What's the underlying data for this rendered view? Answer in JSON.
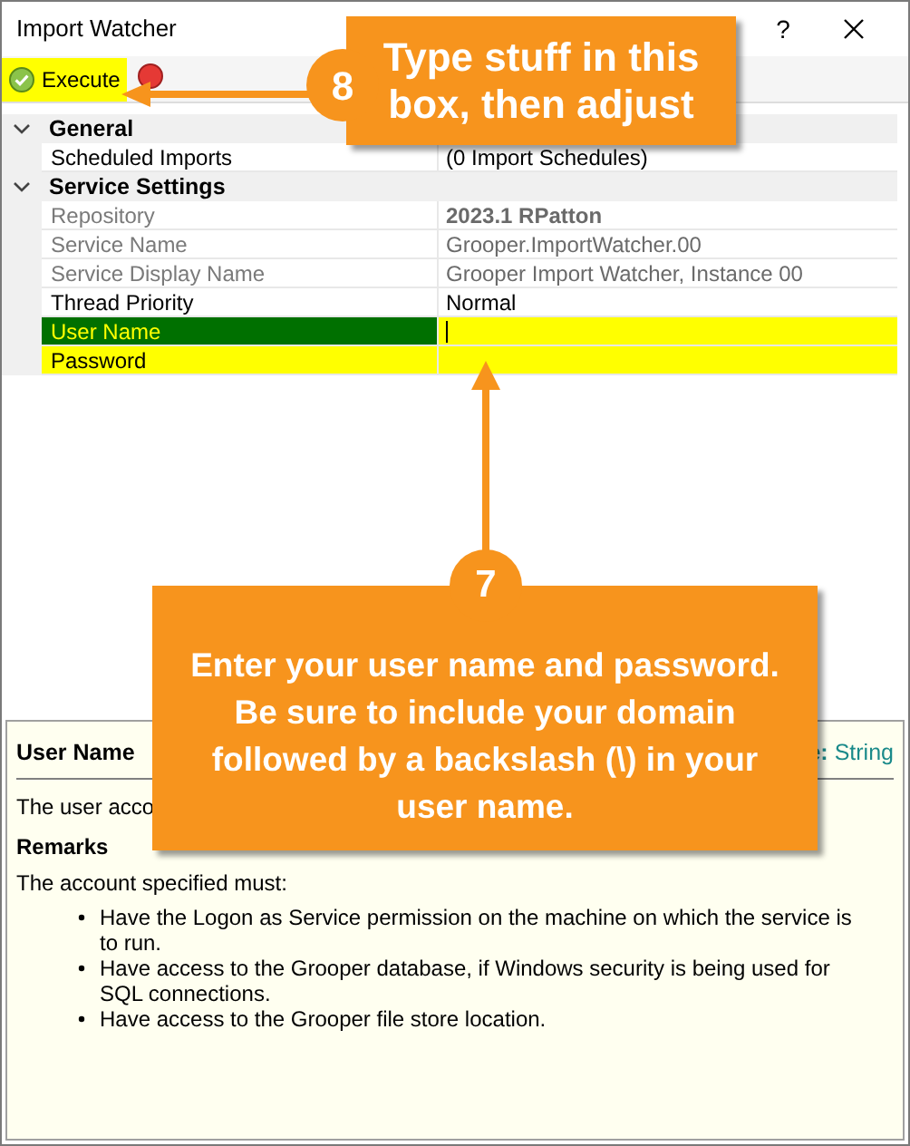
{
  "window": {
    "title": "Import Watcher",
    "help_button": "?"
  },
  "toolbar": [
    {
      "kind": "execute",
      "label": "Execute",
      "highlighted": true
    },
    {
      "kind": "cancel",
      "highlighted": false
    }
  ],
  "property_grid": [
    {
      "name": "General",
      "expanded": true,
      "properties": [
        {
          "name": "Scheduled Imports",
          "value": "(0 Import Schedules)",
          "disabled": false,
          "bold": false,
          "selected": false,
          "highlighted": false
        }
      ]
    },
    {
      "name": "Service Settings",
      "expanded": true,
      "properties": [
        {
          "name": "Repository",
          "value": "2023.1 RPatton",
          "disabled": true,
          "bold": true,
          "selected": false,
          "highlighted": false
        },
        {
          "name": "Service Name",
          "value": "Grooper.ImportWatcher.00",
          "disabled": true,
          "bold": false,
          "selected": false,
          "highlighted": false
        },
        {
          "name": "Service Display Name",
          "value": "Grooper Import Watcher, Instance 00",
          "disabled": true,
          "bold": false,
          "selected": false,
          "highlighted": false
        },
        {
          "name": "Thread Priority",
          "value": "Normal",
          "disabled": false,
          "bold": false,
          "selected": false,
          "highlighted": false
        },
        {
          "name": "User Name",
          "disabled": false,
          "bold": false,
          "selected": true,
          "highlighted": true
        },
        {
          "name": "Password",
          "disabled": false,
          "bold": false,
          "selected": false,
          "highlighted": true
        }
      ]
    }
  ],
  "help": {
    "title": "User Name",
    "type": "**e:** String",
    "description": "The user acco",
    "remarks_heading": "Remarks",
    "remarks_intro": "The account specified must:",
    "bullets": [
      "Have the Logon as Service permission on the machine on which the service is to run.",
      "Have access to the Grooper database, if Windows security is being used for SQL connections.",
      "Have access to the Grooper file store location."
    ]
  },
  "callouts": [
    {
      "number": "8",
      "text": "Type stuff in this box, then adjust"
    },
    {
      "number": "7",
      "text": "Enter your user name and password. Be sure to include your domain followed by a backslash (\\) in your user name."
    }
  ]
}
